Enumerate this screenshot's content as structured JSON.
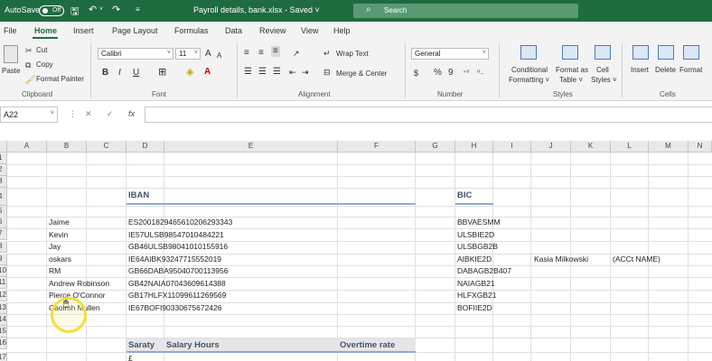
{
  "titlebar": {
    "autosave": "AutoSave",
    "toggle": "Off",
    "doc_title": "Payroll details, bank.xlsx  -  Saved  ˅",
    "search_placeholder": "Search"
  },
  "menu": [
    "File",
    "Home",
    "Insert",
    "Page Layout",
    "Formulas",
    "Data",
    "Review",
    "View",
    "Help"
  ],
  "ribbon": {
    "clipboard": {
      "paste": "Paste",
      "cut": "Cut",
      "copy": "Copy",
      "format_painter": "Format Painter",
      "label": "Clipboard"
    },
    "font": {
      "family": "Calibri",
      "size": "11",
      "bold": "B",
      "italic": "I",
      "underline": "U",
      "grow": "A",
      "shrink": "A",
      "label": "Font"
    },
    "alignment": {
      "wrap_text": "Wrap Text",
      "merge_center": "Merge & Center",
      "label": "Alignment"
    },
    "number": {
      "format": "General",
      "currency": "$",
      "percent": "%",
      "comma": "9",
      "label": "Number"
    },
    "styles": {
      "conditional_1": "Conditional",
      "conditional_2": "Formatting ˅",
      "table_1": "Format as",
      "table_2": "Table ˅",
      "cell_1": "Cell",
      "cell_2": "Styles ˅",
      "label": "Styles"
    },
    "cells": {
      "insert": "Insert",
      "delete": "Delete",
      "format": "Format",
      "label": "Cells"
    }
  },
  "formula_bar": {
    "name_box": "A22",
    "cancel": "✕",
    "enter": "✓",
    "fx": "fx",
    "content": ""
  },
  "columns": [
    "A",
    "B",
    "C",
    "D",
    "E",
    "F",
    "G",
    "H",
    "I",
    "J",
    "K",
    "L",
    "M",
    "N"
  ],
  "rows": [
    "1",
    "2",
    "3",
    "4",
    "5",
    "6",
    "7",
    "8",
    "9",
    "10",
    "11",
    "12",
    "13",
    "14",
    "15",
    "16",
    "17"
  ],
  "sheet": {
    "iban_header": "IBAN",
    "bic_header": "BIC",
    "names": [
      "Jaime",
      "Kevin",
      "Jay",
      "oskars",
      "RM",
      "Andrew Robinson",
      "Pierce O'Connor",
      "Caoimh Mullen"
    ],
    "ibans": [
      "ES2001829465610206293343",
      "IE57ULSB98547010484221",
      "GB46ULSB98041010155916",
      "IE64AIBK93247715552019",
      "GB66DABA95040700113956",
      "GB42NAIA07043609614388",
      "GB17HLFX11099611269569",
      "IE67BOFI90330675672426"
    ],
    "bics": [
      "BBVAESMM",
      "ULSBIE2D",
      "ULSBGB2B",
      "AIBKIE2D",
      "DABAGB2B407",
      "NAIAGB21",
      "HLFXGB21",
      "BOFIIE2D"
    ],
    "extra_name": "Kasia Milkowski",
    "extra_note": "(ACCt NAME)",
    "saraty": "Saraty",
    "salary_hours": "Salary Hours",
    "overtime_rate": "Overtime rate",
    "partial": "£"
  }
}
